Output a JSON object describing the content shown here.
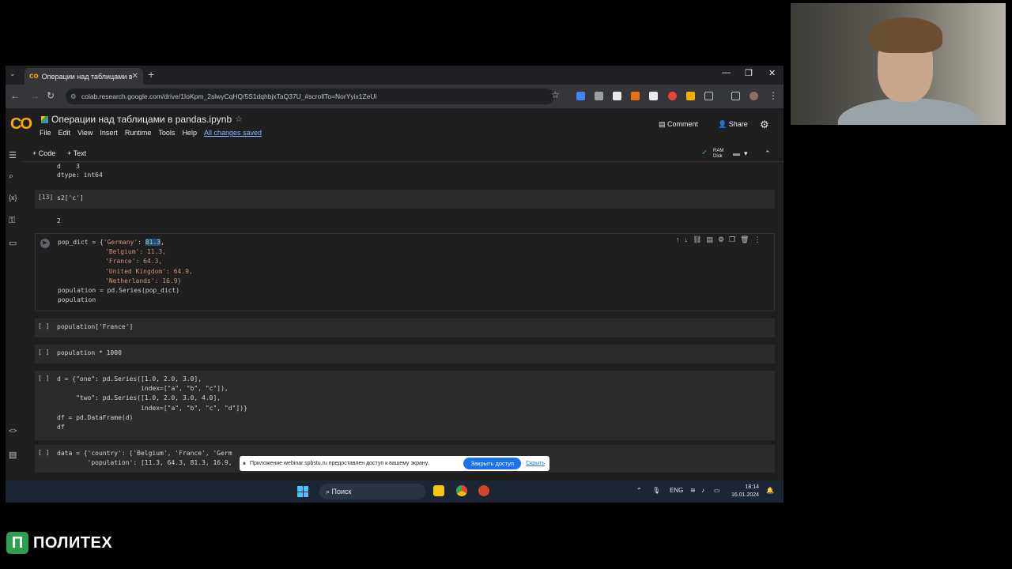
{
  "browser": {
    "tab_title": "Операции над таблицами в p",
    "url": "colab.research.google.com/drive/1IoKpm_2slwyCqHQ/5S1dqhbjxTaQ37U_#scrollTo=NorYyix1ZeUi"
  },
  "colab": {
    "notebook_title": "Операции над таблицами в pandas.ipynb",
    "menus": [
      "File",
      "Edit",
      "View",
      "Insert",
      "Runtime",
      "Tools",
      "Help"
    ],
    "saved_status": "All changes saved",
    "comment_label": "Comment",
    "share_label": "Share",
    "add_code_label": "+ Code",
    "add_text_label": "+ Text",
    "ram_label": "RAM",
    "disk_label": "Disk"
  },
  "cells": {
    "prev_output": {
      "line1": "d    3",
      "line2": "dtype: int64"
    },
    "cell13": {
      "prompt": "[13]",
      "code": "s2['c']",
      "output": "2"
    },
    "pop_dict": {
      "line1_pre": "pop_dict = {",
      "line1_str": "'Germany'",
      "line1_colon": ": ",
      "line1_val": "81.3",
      "lines": [
        "'Belgium': 11.3,",
        "'France': 64.3,",
        "'United Kingdom': 64.9,",
        "'Netherlands': 16.9}"
      ],
      "line_series": "population = pd.Series(pop_dict)",
      "line_pop": "population"
    },
    "france": {
      "prompt": "[ ]",
      "code": "population['France']"
    },
    "times": {
      "prompt": "[ ]",
      "code": "population * 1000"
    },
    "df": {
      "prompt": "[ ]",
      "lines": [
        "d = {\"one\": pd.Series([1.0, 2.0, 3.0],",
        "                      index=[\"a\", \"b\", \"c\"]),",
        "     \"two\": pd.Series([1.0, 2.0, 3.0, 4.0],",
        "                      index=[\"a\", \"b\", \"c\", \"d\"])}",
        "df = pd.DataFrame(d)",
        "df"
      ]
    },
    "data": {
      "prompt": "[ ]",
      "line1": "data = {'country': ['Belgium', 'France', 'Germ",
      "line2": "        'population': [11.3, 64.3, 81.3, 16.9,"
    }
  },
  "banner": {
    "message": "Приложение webinar.spbstu.ru предоставлен доступ к вашему экрану.",
    "stop_label": "Закрыть доступ",
    "hide_label": "Скрыть"
  },
  "taskbar": {
    "search_label": "Поиск",
    "lang": "ENG",
    "time": "18:14",
    "date": "16.01.2024"
  },
  "brand": {
    "mark": "П",
    "name": "ПОЛИТЕХ"
  }
}
